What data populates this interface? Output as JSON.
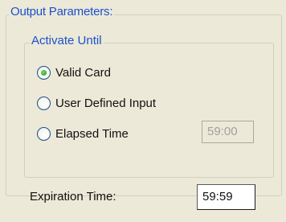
{
  "output_parameters": {
    "title": "Output Parameters:",
    "activate_until": {
      "title": "Activate Until",
      "options": [
        {
          "label": "Valid Card",
          "selected": true
        },
        {
          "label": "User Defined Input",
          "selected": false
        },
        {
          "label": "Elapsed Time",
          "selected": false
        }
      ],
      "elapsed_time_value": "59:00",
      "elapsed_time_enabled": false
    },
    "expiration": {
      "label": "Expiration Time:",
      "value": "59:59"
    }
  },
  "colors": {
    "group_title": "#1C4FCB",
    "background": "#ECE9D8",
    "radio_selected": "#3FB43A"
  }
}
